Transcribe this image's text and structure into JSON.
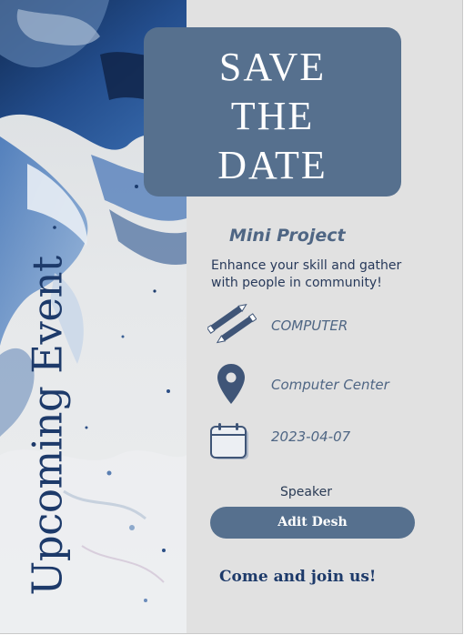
{
  "card": {
    "lines": [
      "SAVE",
      "THE",
      "DATE"
    ]
  },
  "side_title": "Upcoming Event",
  "event": {
    "title": "Mini Project",
    "tagline": "Enhance your skill and gather with people in community!"
  },
  "details": {
    "category": "COMPUTER",
    "location": "Computer Center",
    "date": "2023-04-07"
  },
  "speaker": {
    "label": "Speaker",
    "name": "Adit Desh"
  },
  "cta": "Come and join us!",
  "icons": {
    "category": "pencils-icon",
    "location": "map-pin-icon",
    "date": "calendar-icon"
  },
  "colors": {
    "background": "#e1e1e1",
    "card": "#56708e",
    "heading": "#1d3a6a",
    "accent_text": "#4f6684",
    "paint_blue": "#2e5fa3"
  }
}
